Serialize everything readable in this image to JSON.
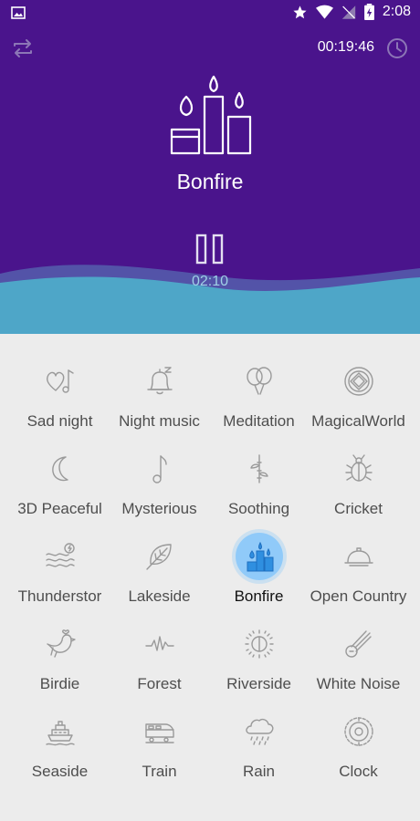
{
  "status_bar": {
    "time": "2:08"
  },
  "player": {
    "timer": "00:19:46",
    "title": "Bonfire",
    "elapsed": "02:10",
    "state_icon": "pause-icon"
  },
  "colors": {
    "header_bg": "#4a148c",
    "wave": "#4ea6c8",
    "selected": "#90caf9"
  },
  "sounds": [
    {
      "label": "Sad night",
      "icon": "heart-note-icon"
    },
    {
      "label": "Night music",
      "icon": "bell-icon"
    },
    {
      "label": "Meditation",
      "icon": "balloons-icon"
    },
    {
      "label": "MagicalWorld",
      "icon": "magic-circle-icon"
    },
    {
      "label": "3D Peaceful",
      "icon": "moon-icon"
    },
    {
      "label": "Mysterious",
      "icon": "music-note-icon"
    },
    {
      "label": "Soothing",
      "icon": "bamboo-icon"
    },
    {
      "label": "Cricket",
      "icon": "bug-icon"
    },
    {
      "label": "Thunderstor",
      "icon": "thunder-waves-icon"
    },
    {
      "label": "Lakeside",
      "icon": "leaf-icon"
    },
    {
      "label": "Bonfire",
      "icon": "candles-icon",
      "selected": true
    },
    {
      "label": "Open Country",
      "icon": "cloche-icon"
    },
    {
      "label": "Birdie",
      "icon": "bird-icon"
    },
    {
      "label": "Forest",
      "icon": "pulse-icon"
    },
    {
      "label": "Riverside",
      "icon": "sun-icon"
    },
    {
      "label": "White Noise",
      "icon": "comet-icon"
    },
    {
      "label": "Seaside",
      "icon": "ship-icon"
    },
    {
      "label": "Train",
      "icon": "train-icon"
    },
    {
      "label": "Rain",
      "icon": "rain-cloud-icon"
    },
    {
      "label": "Clock",
      "icon": "clock-ring-icon"
    }
  ]
}
